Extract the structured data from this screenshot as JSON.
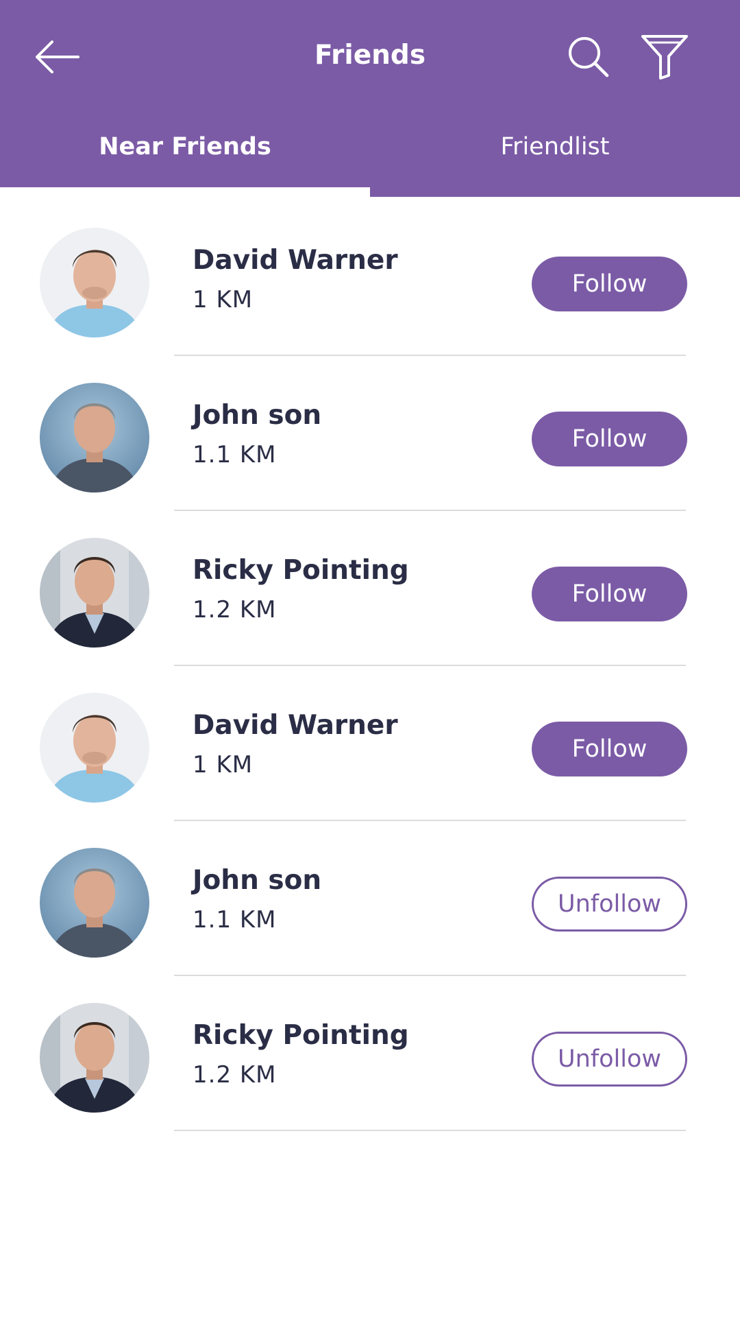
{
  "header": {
    "title": "Friends",
    "back_icon": "arrow-left-icon",
    "search_icon": "search-icon",
    "filter_icon": "filter-icon",
    "background_color": "#7b5ba6"
  },
  "tabs": [
    {
      "label": "Near Friends",
      "active": true
    },
    {
      "label": "Friendlist",
      "active": false
    }
  ],
  "friends": [
    {
      "name": "David Warner",
      "distance": "1 KM",
      "action": "Follow",
      "state": "follow"
    },
    {
      "name": "John son",
      "distance": "1.1 KM",
      "action": "Follow",
      "state": "follow"
    },
    {
      "name": "Ricky Pointing",
      "distance": "1.2 KM",
      "action": "Follow",
      "state": "follow"
    },
    {
      "name": "David Warner",
      "distance": "1 KM",
      "action": "Follow",
      "state": "follow"
    },
    {
      "name": "John son",
      "distance": "1.1 KM",
      "action": "Unfollow",
      "state": "unfollow"
    },
    {
      "name": "Ricky Pointing",
      "distance": "1.2 KM",
      "action": "Unfollow",
      "state": "unfollow"
    }
  ],
  "colors": {
    "accent": "#7b5ba6",
    "text": "#2a2d45",
    "divider": "#dcdcdc"
  }
}
